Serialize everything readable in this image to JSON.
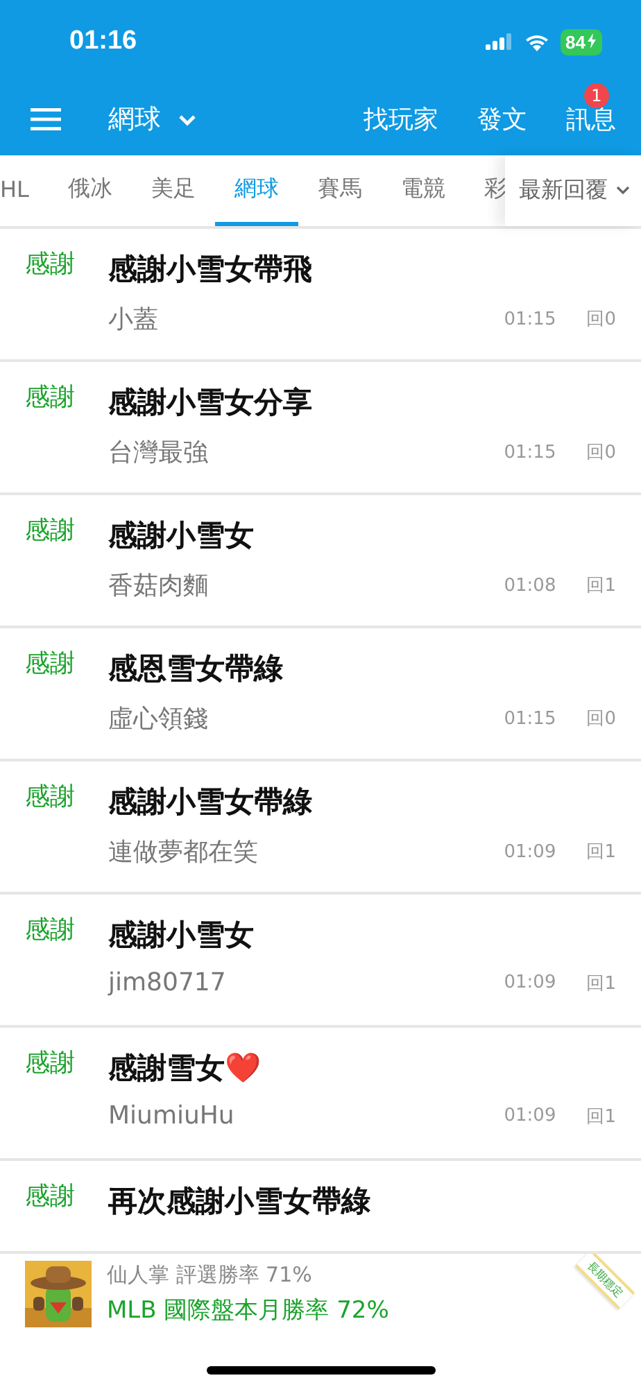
{
  "status_bar": {
    "time": "01:16",
    "battery": "84"
  },
  "nav": {
    "board": "網球",
    "actions": [
      {
        "label": "找玩家"
      },
      {
        "label": "發文"
      },
      {
        "label": "訊息",
        "badge": "1"
      }
    ]
  },
  "tabs": [
    {
      "label": "HL",
      "selected": false
    },
    {
      "label": "俄冰",
      "selected": false
    },
    {
      "label": "美足",
      "selected": false
    },
    {
      "label": "網球",
      "selected": true
    },
    {
      "label": "賽馬",
      "selected": false
    },
    {
      "label": "電競",
      "selected": false
    },
    {
      "label": "彩",
      "selected": false
    }
  ],
  "sort": {
    "label": "最新回覆"
  },
  "posts": [
    {
      "tag": "感謝",
      "title": "感謝小雪女帶飛",
      "author": "小蓋",
      "time": "01:15",
      "replies": "回0"
    },
    {
      "tag": "感謝",
      "title": "感謝小雪女分享",
      "author": "台灣最強",
      "time": "01:15",
      "replies": "回0"
    },
    {
      "tag": "感謝",
      "title": "感謝小雪女",
      "author": "香菇肉麵",
      "time": "01:08",
      "replies": "回1"
    },
    {
      "tag": "感謝",
      "title": "感恩雪女帶綠",
      "author": "虛心領錢",
      "time": "01:15",
      "replies": "回0"
    },
    {
      "tag": "感謝",
      "title": "感謝小雪女帶綠",
      "author": "連做夢都在笑",
      "time": "01:09",
      "replies": "回1"
    },
    {
      "tag": "感謝",
      "title": "感謝小雪女",
      "author": "jim80717",
      "time": "01:09",
      "replies": "回1"
    },
    {
      "tag": "感謝",
      "title": "感謝雪女❤️",
      "author": "MiumiuHu",
      "time": "01:09",
      "replies": "回1"
    },
    {
      "tag": "感謝",
      "title": "再次感謝小雪女帶綠"
    }
  ],
  "banner": {
    "line_1": "仙人掌 評選勝率 71%",
    "line_2": "MLB 國際盤本月勝率 72%",
    "ribbon": "長期穩定"
  }
}
